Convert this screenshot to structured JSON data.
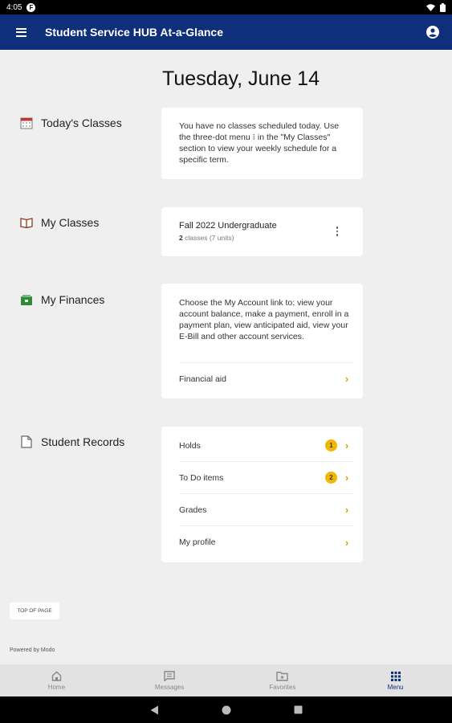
{
  "status_bar": {
    "time": "4:05",
    "app_badge": "F"
  },
  "app_bar": {
    "title": "Student Service HUB At-a-Glance"
  },
  "date_heading": "Tuesday, June 14",
  "sections": {
    "todays_classes": {
      "label": "Today's Classes",
      "message": "You have no classes scheduled today. Use the three-dot menu ⁝ in the \"My Classes\" section to view your weekly schedule for a specific term."
    },
    "my_classes": {
      "label": "My Classes",
      "term": "Fall 2022 Undergraduate",
      "count": "2",
      "count_suffix": "classes (7 units)"
    },
    "my_finances": {
      "label": "My Finances",
      "message": "Choose the My Account link to: view your account balance, make a payment, enroll in a payment plan, view anticipated aid, view your E-Bill and other account services.",
      "link": "Financial aid"
    },
    "student_records": {
      "label": "Student Records",
      "items": [
        {
          "label": "Holds",
          "badge": "1"
        },
        {
          "label": "To Do items",
          "badge": "2"
        },
        {
          "label": "Grades"
        },
        {
          "label": "My profile"
        }
      ]
    }
  },
  "footer": {
    "top_of_page": "TOP OF PAGE",
    "powered_by": "Powered by Modo"
  },
  "bottom_nav": {
    "items": [
      {
        "label": "Home",
        "icon": "home-icon"
      },
      {
        "label": "Messages",
        "icon": "messages-icon"
      },
      {
        "label": "Favorites",
        "icon": "favorites-icon"
      },
      {
        "label": "Menu",
        "icon": "grid-icon"
      }
    ],
    "active": "Menu"
  },
  "colors": {
    "app_bar": "#0f2f7a",
    "accent": "#e5a100",
    "badge": "#f2b705",
    "background": "#efefef"
  }
}
